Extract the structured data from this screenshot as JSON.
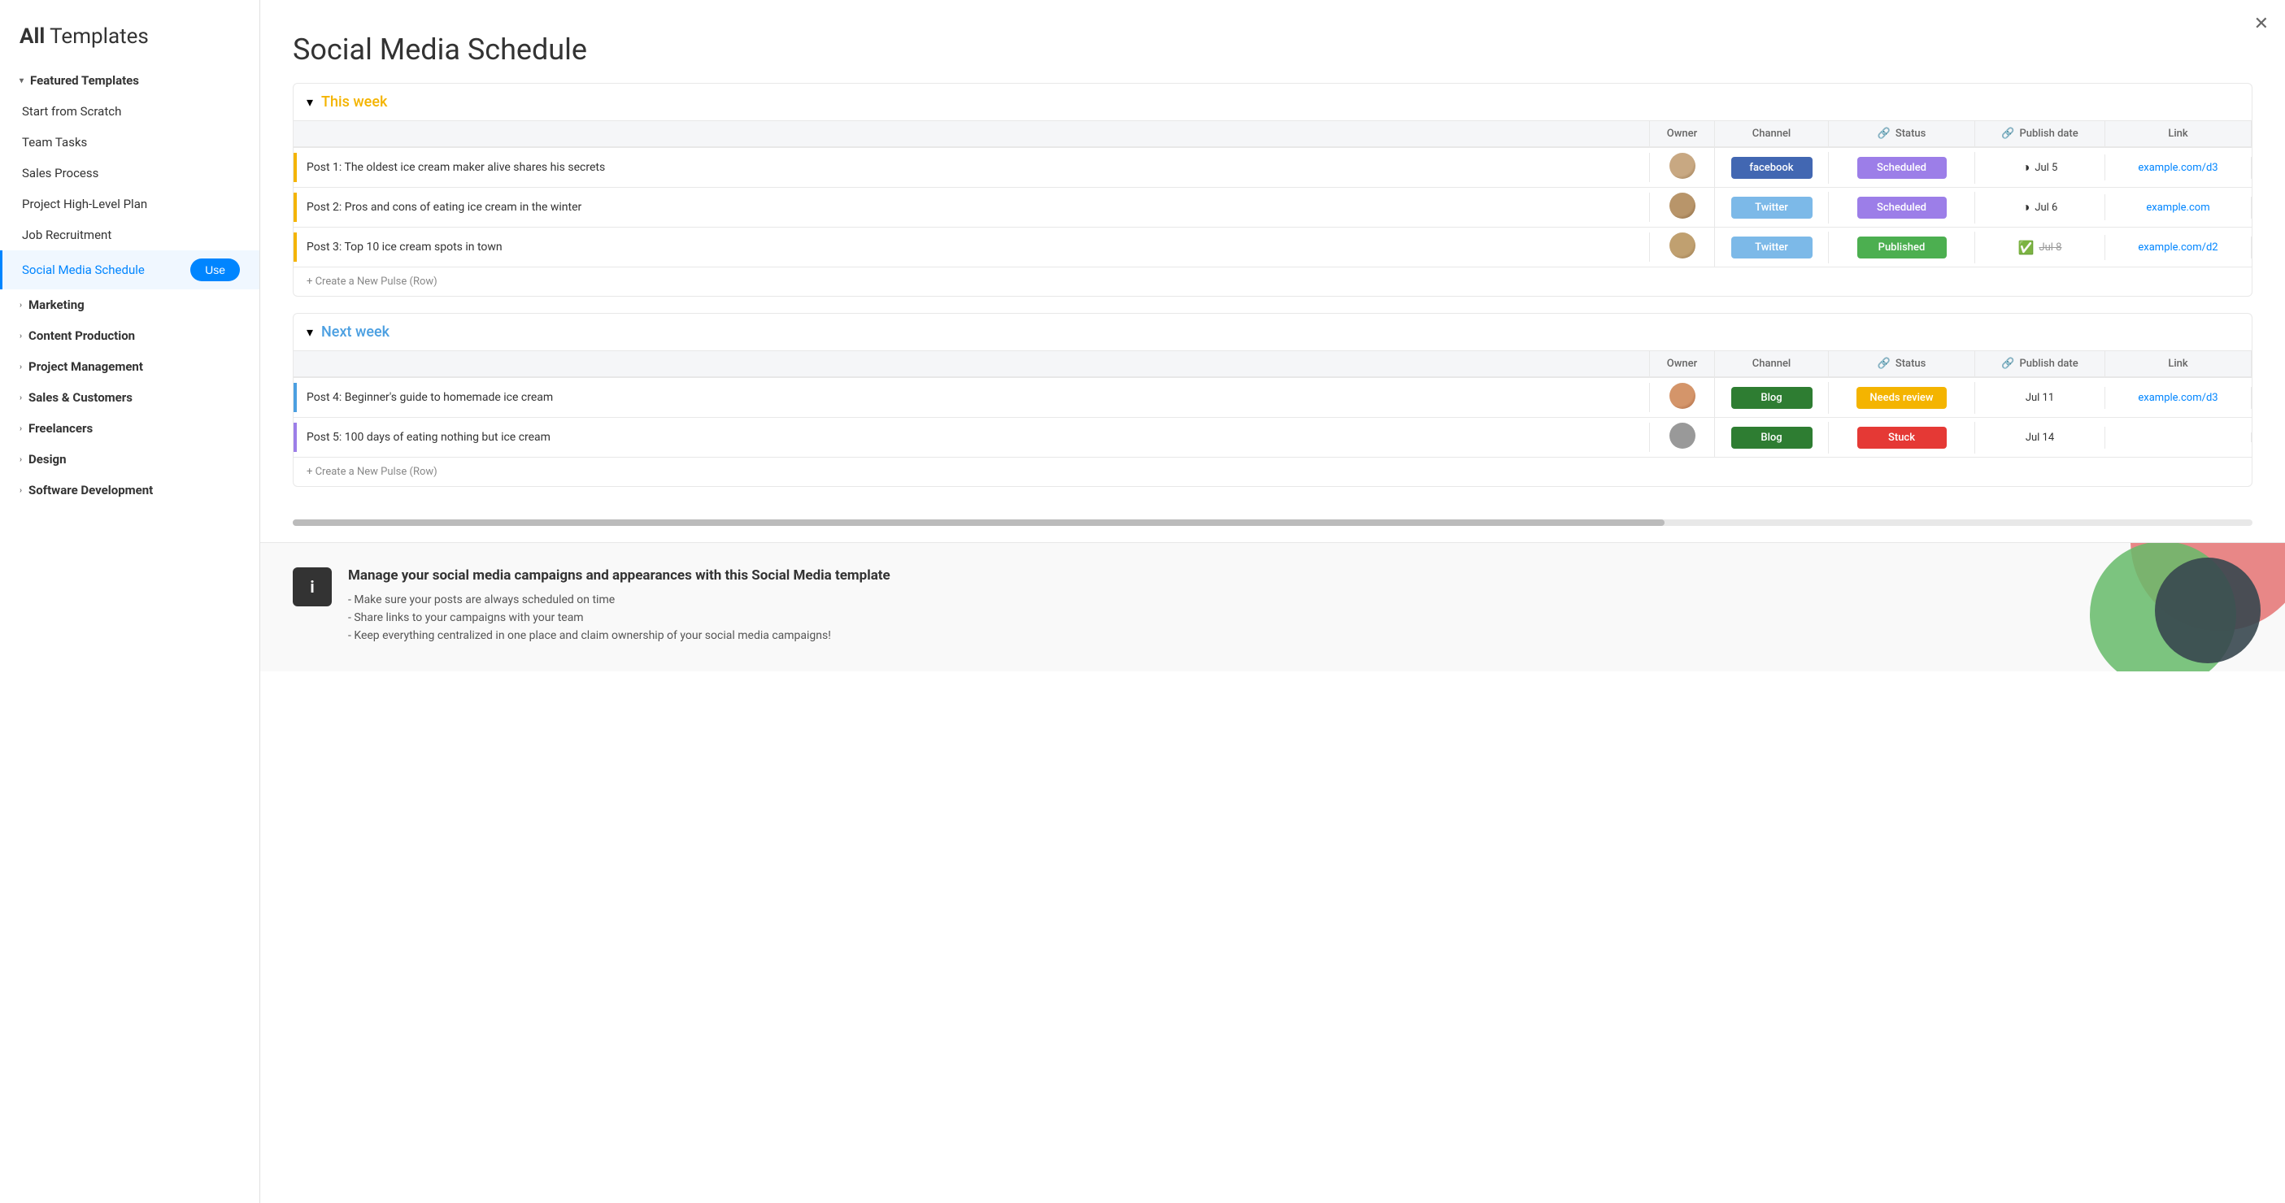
{
  "sidebar": {
    "title_bold": "All",
    "title_rest": " Templates",
    "sections": [
      {
        "id": "featured",
        "label": "Featured Templates",
        "expanded": true,
        "items": [
          {
            "id": "start-scratch",
            "label": "Start from Scratch",
            "active": false
          },
          {
            "id": "team-tasks",
            "label": "Team Tasks",
            "active": false
          },
          {
            "id": "sales-process",
            "label": "Sales Process",
            "active": false
          },
          {
            "id": "project-plan",
            "label": "Project High-Level Plan",
            "active": false
          },
          {
            "id": "job-recruitment",
            "label": "Job Recruitment",
            "active": false
          },
          {
            "id": "social-media",
            "label": "Social Media Schedule",
            "active": true
          }
        ]
      },
      {
        "id": "marketing",
        "label": "Marketing",
        "expanded": false,
        "items": []
      },
      {
        "id": "content",
        "label": "Content Production",
        "expanded": false,
        "items": []
      },
      {
        "id": "project-mgmt",
        "label": "Project Management",
        "expanded": false,
        "items": []
      },
      {
        "id": "sales-customers",
        "label": "Sales & Customers",
        "expanded": false,
        "items": []
      },
      {
        "id": "freelancers",
        "label": "Freelancers",
        "expanded": false,
        "items": []
      },
      {
        "id": "design",
        "label": "Design",
        "expanded": false,
        "items": []
      },
      {
        "id": "software-dev",
        "label": "Software Development",
        "expanded": false,
        "items": []
      }
    ]
  },
  "main": {
    "title": "Social Media Schedule",
    "close_label": "✕",
    "groups": [
      {
        "id": "this-week",
        "title": "This week",
        "color": "yellow",
        "col_headers": [
          "",
          "Owner",
          "Channel",
          "Status",
          "Publish date",
          "Link"
        ],
        "rows": [
          {
            "name": "Post 1: The oldest ice cream maker alive shares his secrets",
            "border": "gold",
            "channel": "facebook",
            "channel_label": "facebook",
            "status": "scheduled",
            "status_label": "Scheduled",
            "date": "Jul 5",
            "date_icon": "half-circle",
            "link": "example.com/d3",
            "strikethrough": false
          },
          {
            "name": "Post 2: Pros and cons of eating ice cream in the winter",
            "border": "gold",
            "channel": "twitter",
            "channel_label": "Twitter",
            "status": "scheduled",
            "status_label": "Scheduled",
            "date": "Jul 6",
            "date_icon": "half-circle",
            "link": "example.com",
            "strikethrough": false
          },
          {
            "name": "Post 3: Top 10 ice cream spots in town",
            "border": "gold",
            "channel": "twitter",
            "channel_label": "Twitter",
            "status": "published",
            "status_label": "Published",
            "date": "Jul 8",
            "date_icon": "check",
            "link": "example.com/d2",
            "strikethrough": true
          }
        ],
        "create_label": "+ Create a New Pulse (Row)"
      },
      {
        "id": "next-week",
        "title": "Next week",
        "color": "blue",
        "col_headers": [
          "",
          "Owner",
          "Channel",
          "Status",
          "Publish date",
          "Link"
        ],
        "rows": [
          {
            "name": "Post 4: Beginner's guide to homemade ice cream",
            "border": "blue-border",
            "channel": "blog",
            "channel_label": "Blog",
            "status": "needs-review",
            "status_label": "Needs review",
            "date": "Jul 11",
            "date_icon": "none",
            "link": "example.com/d3",
            "strikethrough": false
          },
          {
            "name": "Post 5: 100 days of eating nothing but ice cream",
            "border": "purple-border",
            "channel": "blog",
            "channel_label": "Blog",
            "status": "stuck",
            "status_label": "Stuck",
            "date": "Jul 14",
            "date_icon": "none",
            "link": "",
            "strikethrough": false
          }
        ],
        "create_label": "+ Create a New Pulse (Row)"
      }
    ],
    "info": {
      "icon": "i",
      "title": "Manage your social media campaigns and appearances with this Social Media template",
      "bullets": [
        "- Make sure your posts are always scheduled on time",
        "- Share links to your campaigns with your team",
        "- Keep everything centralized in one place and claim ownership of your social media campaigns!"
      ]
    }
  }
}
